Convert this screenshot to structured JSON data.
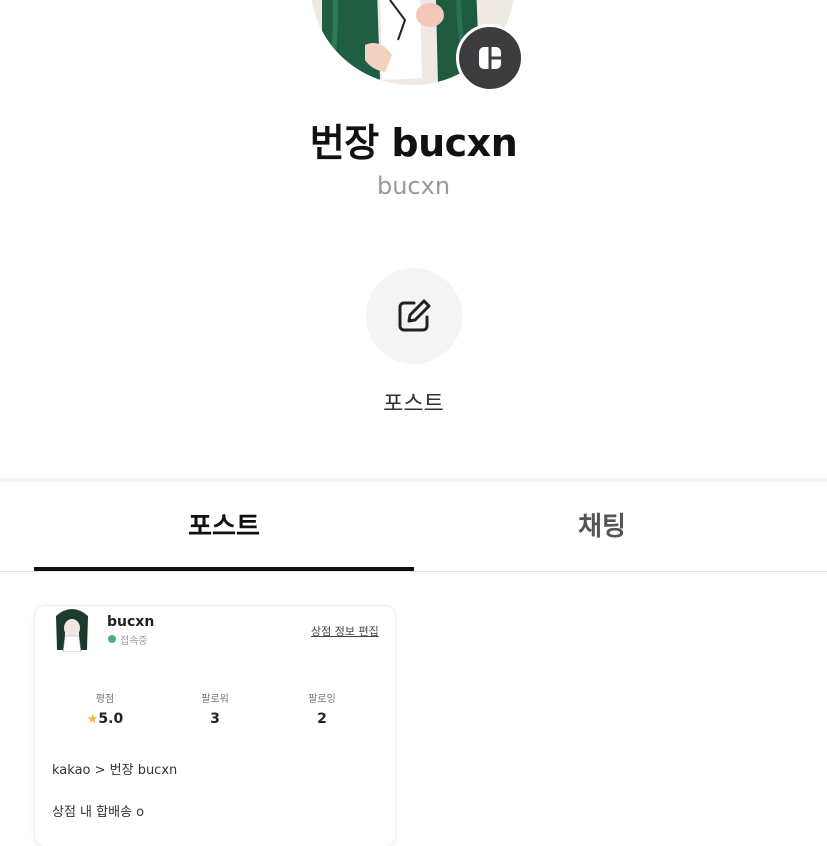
{
  "profile": {
    "name": "번장 bucxn",
    "handle": "bucxn"
  },
  "actions": {
    "post_label": "포스트"
  },
  "tabs": [
    {
      "label": "포스트",
      "active": true
    },
    {
      "label": "채팅",
      "active": false
    }
  ],
  "card": {
    "username": "bucxn",
    "status": "접속중",
    "edit_link": "상점 정보 편집",
    "stats": [
      {
        "label": "평점",
        "value": "5.0"
      },
      {
        "label": "팔로워",
        "value": "3"
      },
      {
        "label": "팔로잉",
        "value": "2"
      }
    ],
    "lines": [
      "kakao > 번장 bucxn",
      "상점 내 합배송 o"
    ]
  },
  "icons": {
    "badge": "layout-grid-icon",
    "post_action": "edit-pencil-icon",
    "rating": "star-icon"
  },
  "colors": {
    "badge_bg": "#3d3d3f",
    "status_online": "#4caf7a",
    "star": "#f3b73a",
    "tab_active": "#111111"
  }
}
